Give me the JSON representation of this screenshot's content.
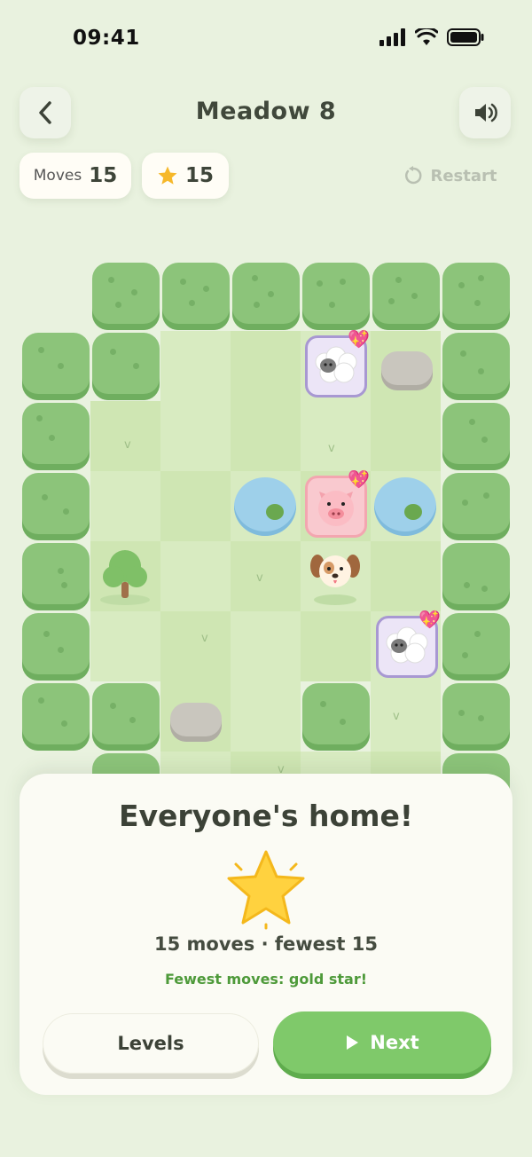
{
  "status_bar": {
    "time": "09:41"
  },
  "header": {
    "title": "Meadow 8",
    "back_icon": "chevron-left-icon",
    "sound_icon": "speaker-icon"
  },
  "stats": {
    "moves_label": "Moves",
    "moves_value": "15",
    "stars_value": "15",
    "restart_label": "Restart"
  },
  "board": {
    "pieces": [
      "sheep",
      "pig",
      "puppy",
      "sheep"
    ],
    "obstacles": [
      "hedge",
      "rock",
      "pond",
      "tree"
    ]
  },
  "modal": {
    "heading": "Everyone's home!",
    "stats_text": "15 moves · fewest 15",
    "note": "Fewest moves: gold star!",
    "levels_label": "Levels",
    "next_label": "Next"
  },
  "colors": {
    "accent": "#7fc96a",
    "background": "#e9f2df",
    "hedge": "#8cc47a",
    "note": "#4e9a3a"
  }
}
